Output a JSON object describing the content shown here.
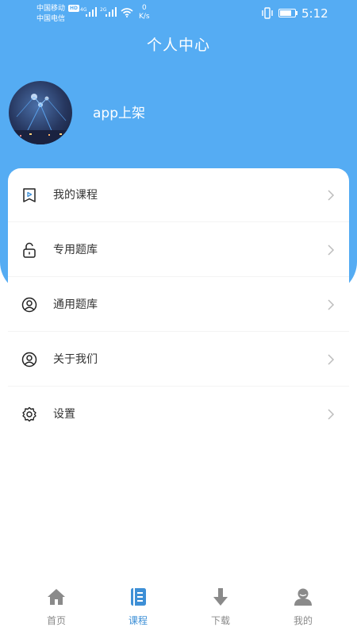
{
  "status_bar": {
    "carrier_1": "中国移动",
    "carrier_2": "中国电信",
    "hd": "HD",
    "net_1": "4G",
    "net_2": "2G",
    "speed_value": "0",
    "speed_unit": "K/s",
    "time": "5:12",
    "battery_level": 0.84
  },
  "header": {
    "title": "个人中心"
  },
  "profile": {
    "username": "app上架"
  },
  "menu": {
    "items": [
      {
        "label": "我的课程",
        "icon": "course-icon"
      },
      {
        "label": "专用题库",
        "icon": "unlock-icon"
      },
      {
        "label": "通用题库",
        "icon": "user-circle-icon"
      },
      {
        "label": "关于我们",
        "icon": "user-circle-icon"
      },
      {
        "label": "设置",
        "icon": "gear-icon"
      }
    ]
  },
  "tab_bar": {
    "tabs": [
      {
        "label": "首页",
        "icon": "home-icon",
        "active": false
      },
      {
        "label": "课程",
        "icon": "book-icon",
        "active": true
      },
      {
        "label": "下载",
        "icon": "download-icon",
        "active": false
      },
      {
        "label": "我的",
        "icon": "profile-icon",
        "active": false
      }
    ]
  },
  "colors": {
    "header_blue": "#55acf3",
    "active_tab": "#3d8fd6",
    "inactive_tab": "#8a8a8a",
    "menu_text": "#333333"
  }
}
